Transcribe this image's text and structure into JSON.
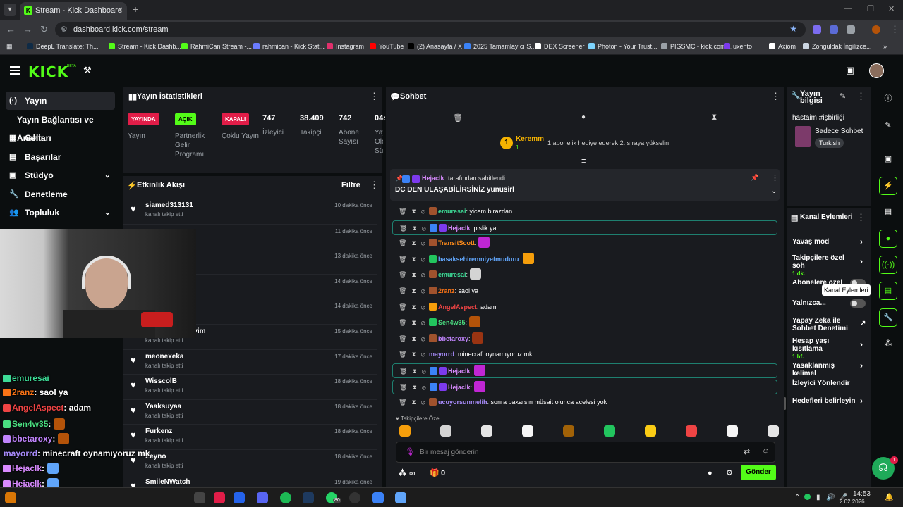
{
  "browser": {
    "tab_title": "Stream - Kick Dashboard",
    "url": "dashboard.kick.com/stream",
    "bookmarks": [
      {
        "label": "DeepL Translate: Th...",
        "color": "#0f2b46"
      },
      {
        "label": "Stream - Kick Dashb...",
        "color": "#53fc18"
      },
      {
        "label": "RahmiCan Stream -...",
        "color": "#53fc18"
      },
      {
        "label": "rahmican - Kick Stat...",
        "color": "#6b7cff"
      },
      {
        "label": "Instagram",
        "color": "#e1306c"
      },
      {
        "label": "YouTube",
        "color": "#ff0000"
      },
      {
        "label": "(2) Anasayfa / X",
        "color": "#000000"
      },
      {
        "label": "2025 Tamamlayıcı S...",
        "color": "#3b82f6"
      },
      {
        "label": "DEX Screener",
        "color": "#ffffff"
      },
      {
        "label": "Photon - Your Trust...",
        "color": "#7dd3fc"
      },
      {
        "label": "PIGSMC - kick.com/...",
        "color": "#9aa0a6"
      },
      {
        "label": "uxento",
        "color": "#7c3aed"
      },
      {
        "label": "Axiom",
        "color": "#ffffff"
      },
      {
        "label": "Zonguldak İngilizce...",
        "color": "#cbd5e1"
      }
    ]
  },
  "header": {
    "logo": "KICK",
    "beta": "BETA"
  },
  "sidebar": {
    "items": [
      {
        "label": "Yayın",
        "icon": "(·)"
      },
      {
        "label": "Yayın Bağlantısı ve Anahtarı",
        "icon": ""
      },
      {
        "label": "Gelir",
        "icon": "▦"
      },
      {
        "label": "Başarılar",
        "icon": "▤"
      },
      {
        "label": "Stüdyo",
        "icon": "▣"
      },
      {
        "label": "Denetleme",
        "icon": "🔧"
      },
      {
        "label": "Topluluk",
        "icon": "👥"
      }
    ]
  },
  "stats": {
    "title": "Yayın İstatistikleri",
    "badges": [
      {
        "label": "YAYINDA",
        "caption": "Yayın",
        "bg": "#e11d48",
        "fg": "#ffffff"
      },
      {
        "label": "AÇIK",
        "caption": "Partnerlik Gelir Programı",
        "bg": "#53fc18",
        "fg": "#000000"
      },
      {
        "label": "KAPALI",
        "caption": "Çoklu Yayın",
        "bg": "#e11d48",
        "fg": "#ffffff"
      }
    ],
    "numbers": [
      {
        "value": "747",
        "label": "İzleyici"
      },
      {
        "value": "38.409",
        "label": "Takipçi"
      },
      {
        "value": "742",
        "label": "Abone Sayısı"
      },
      {
        "value": "04:",
        "label": "Yay Olo Sür"
      }
    ]
  },
  "activity": {
    "title": "Etkinlik Akışı",
    "filter": "Filtre",
    "rows": [
      {
        "name": "siamed313131",
        "sub": "kanalı takip etti",
        "time": "10 dakika önce"
      },
      {
        "name": "",
        "sub": "",
        "time": "11 dakika önce"
      },
      {
        "name": "",
        "sub": "",
        "time": "13 dakika önce"
      },
      {
        "name": "",
        "sub": "",
        "time": "14 dakika önce"
      },
      {
        "name": "",
        "sub": "",
        "time": "14 dakika önce"
      },
      {
        "name": "siyim",
        "sub": "kanalı takip etti",
        "time": "15 dakika önce"
      },
      {
        "name": "meonexeka",
        "sub": "kanalı takip etti",
        "time": "17 dakika önce"
      },
      {
        "name": "WisscolB",
        "sub": "kanalı takip etti",
        "time": "18 dakika önce"
      },
      {
        "name": "Yaaksuyaa",
        "sub": "kanalı takip etti",
        "time": "18 dakika önce"
      },
      {
        "name": "Furkenz",
        "sub": "kanalı takip etti",
        "time": "18 dakika önce"
      },
      {
        "name": "Zeyno",
        "sub": "kanalı takip etti",
        "time": "18 dakika önce"
      },
      {
        "name": "SmileNWatch",
        "sub": "",
        "time": "19 dakika önce"
      }
    ]
  },
  "chat": {
    "title": "Sohbet",
    "top_gifter": {
      "name": "Keremm",
      "count": "1",
      "rank": "1",
      "text": "1 abonelik hediye ederek 2. sıraya yükselin"
    },
    "pinned": {
      "by_user": "Hejaclk",
      "by_text": "tarafından sabitlendi",
      "message": "DC DEN ULAŞABİLİRSİNİZ yunusirl"
    },
    "messages": [
      {
        "user": "emuresai",
        "color": "#3ddc97",
        "text": "yicem birazdan",
        "emote": "",
        "highlight": false,
        "badge": "#a0522d"
      },
      {
        "user": "Hejaclk",
        "color": "#d98bff",
        "text": "pislik ya",
        "emote": "",
        "highlight": true,
        "badge": "#3b82f6"
      },
      {
        "user": "TransitScott",
        "color": "#ff8c1a",
        "text": "",
        "emote": "#c026d3",
        "highlight": false,
        "badge": "#a0522d"
      },
      {
        "user": "basaksehiremniyetmuduru",
        "color": "#60a5fa",
        "text": "",
        "emote": "#f59e0b",
        "highlight": false,
        "badge": "#22c55e"
      },
      {
        "user": "emuresai",
        "color": "#3ddc97",
        "text": "",
        "emote": "#d4d4d4",
        "highlight": false,
        "badge": "#a0522d"
      },
      {
        "user": "2ranz",
        "color": "#f97316",
        "text": "saol ya",
        "emote": "",
        "highlight": false,
        "badge": "#a0522d"
      },
      {
        "user": "AngelAspect",
        "color": "#ef4444",
        "text": "adam",
        "emote": "",
        "highlight": false,
        "badge": "#f59e0b"
      },
      {
        "user": "Sen4w35",
        "color": "#4ade80",
        "text": "",
        "emote": "#b45309",
        "highlight": false,
        "badge": "#22c55e"
      },
      {
        "user": "bbetaroxy",
        "color": "#c084fc",
        "text": "",
        "emote": "#9a3412",
        "highlight": false,
        "badge": "#a0522d"
      },
      {
        "user": "mayorrd",
        "color": "#a78bfa",
        "text": "minecraft oynamıyoruz mk",
        "emote": "",
        "highlight": false,
        "badge": ""
      },
      {
        "user": "Hejaclk",
        "color": "#d98bff",
        "text": "",
        "emote": "#c026d3",
        "highlight": true,
        "badge": "#3b82f6"
      },
      {
        "user": "Hejaclk",
        "color": "#d98bff",
        "text": "",
        "emote": "#c026d3",
        "highlight": true,
        "badge": "#3b82f6"
      },
      {
        "user": "ucuyorsunmelih",
        "color": "#a78bfa",
        "text": "sonra bakarsın müsait olunca acelesi yok",
        "emote": "",
        "highlight": false,
        "badge": "#a0522d"
      }
    ],
    "followers_only": "Takipçilere Özel",
    "emotes": [
      "#f59e0b",
      "#d4d4d4",
      "#e5e5e5",
      "#f5f5f5",
      "#a16207",
      "#22c55e",
      "#facc15",
      "#ef4444",
      "#f5f5f5",
      "#e5e5e5"
    ],
    "input_placeholder": "Bir mesaj gönderin",
    "send": "Gönder",
    "count_left": "∞",
    "count_right": "0"
  },
  "stream_info": {
    "title": "Yayın bilgisi",
    "stream_title": "hastaim #işbirliği",
    "category": "Sadece Sohbet",
    "language": "Turkish"
  },
  "channel_actions": {
    "title": "Kanal Eylemleri",
    "tooltip": "Kanal Eylemleri",
    "items": [
      {
        "label": "Yavaş mod",
        "sub": "",
        "control": "chevron"
      },
      {
        "label": "Takipçilere özel soh",
        "sub": "1 dk.",
        "control": "chevron"
      },
      {
        "label": "Abonelere özel",
        "sub": "",
        "control": "toggle"
      },
      {
        "label": "Yalnızca...",
        "sub": "",
        "control": "toggle"
      },
      {
        "label": "Yapay Zeka ile Sohbet Denetimi",
        "sub": "",
        "control": "external"
      },
      {
        "label": "Hesap yaşı kısıtlama",
        "sub": "1 hf.",
        "control": "chevron"
      },
      {
        "label": "Yasaklanmış kelimel",
        "sub": "",
        "control": "chevron"
      },
      {
        "label": "İzleyici Yönlendir",
        "sub": "",
        "control": ""
      },
      {
        "label": "Hedefleri belirleyin",
        "sub": "",
        "control": "chevron"
      }
    ]
  },
  "overlay_chat": [
    {
      "user": "emuresai",
      "text": "",
      "color": "#3ddc97"
    },
    {
      "user": "2ranz",
      "text": ": saol ya",
      "color": "#f97316"
    },
    {
      "user": "AngelAspect",
      "text": ": adam",
      "color": "#ef4444"
    },
    {
      "user": "Sen4w35",
      "text": ":",
      "color": "#4ade80"
    },
    {
      "user": "bbetaroxy",
      "text": ":",
      "color": "#c084fc"
    },
    {
      "user": "mayorrd",
      "text": ": minecraft oynamıyoruz mk",
      "color": "#a78bfa"
    },
    {
      "user": "Hejaclk",
      "text": ":",
      "color": "#d98bff"
    },
    {
      "user": "Hejaclk",
      "text": ":",
      "color": "#d98bff"
    },
    {
      "user": "ucuyorsunmelih",
      "text": ": sonra bakarsın müsait olunca acelesi yok",
      "color": "#a78bfa"
    }
  ],
  "taskbar": {
    "time": "14:53",
    "date": "2.02.2026",
    "badge_count": "80",
    "notif_count": "1"
  }
}
